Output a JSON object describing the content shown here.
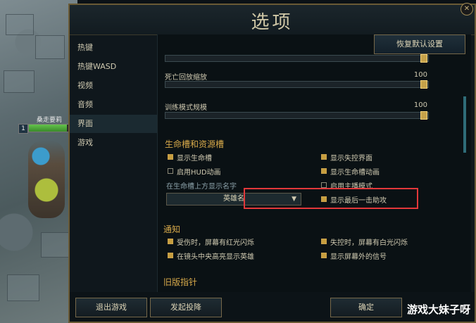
{
  "window": {
    "title": "选项"
  },
  "sidebar": {
    "items": [
      {
        "label": "热键"
      },
      {
        "label": "热键WASD"
      },
      {
        "label": "视频"
      },
      {
        "label": "音频"
      },
      {
        "label": "界面",
        "active": true
      },
      {
        "label": "游戏"
      }
    ]
  },
  "header": {
    "reset_label": "恢复默认设置"
  },
  "sliders": [
    {
      "label": "死亡回放缩放",
      "value": "100"
    },
    {
      "label": "训练模式规模",
      "value": "100"
    }
  ],
  "sections": {
    "health": {
      "title": "生命槽和资源槽",
      "left": [
        {
          "label": "显示生命槽",
          "checked": true
        },
        {
          "label": "启用HUD动画",
          "checked": false
        }
      ],
      "right": [
        {
          "label": "显示失控界面",
          "checked": true
        },
        {
          "label": "显示生命槽动画",
          "checked": true
        },
        {
          "label": "启用主播模式",
          "checked": false
        },
        {
          "label": "显示最后一击助攻",
          "checked": true
        }
      ],
      "nameplate_label": "在生命槽上方显示名字",
      "nameplate_value": "英雄名"
    },
    "notify": {
      "title": "通知",
      "items": [
        {
          "label": "受伤时，屏幕有红光闪烁",
          "checked": true
        },
        {
          "label": "失控时，屏幕有白光闪烁",
          "checked": true
        },
        {
          "label": "在镜头中央高亮显示英雄",
          "checked": true
        },
        {
          "label": "显示屏幕外的信号",
          "checked": true
        }
      ]
    },
    "legacy": {
      "title": "旧版指针"
    }
  },
  "footer": {
    "quit_label": "退出游戏",
    "surrender_label": "发起投降",
    "confirm_label": "确定"
  },
  "game": {
    "player_name": "桑走要莉",
    "level": "1",
    "hp_fraction": 0.9
  },
  "watermark": "游戏大妹子呀",
  "colors": {
    "accent": "#c79e3e",
    "section": "#d7a94a",
    "highlight": "#e2383a"
  }
}
